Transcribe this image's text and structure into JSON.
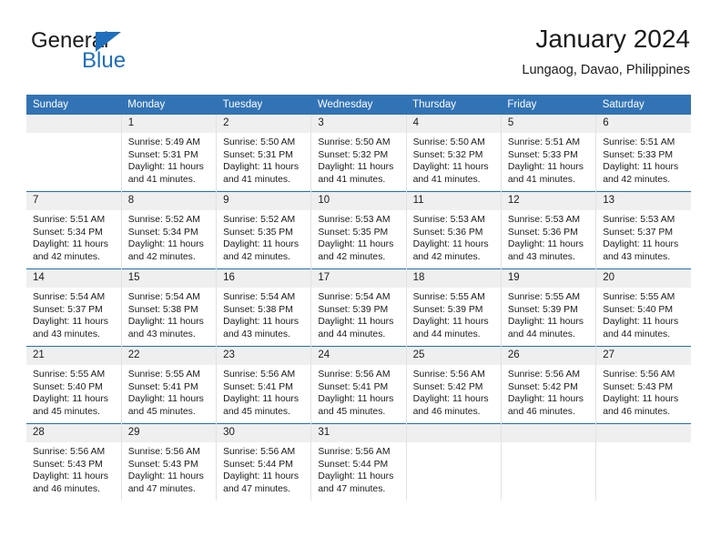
{
  "brand": {
    "name_top": "General",
    "name_bottom": "Blue",
    "triangle_icon": "brand-triangle-icon",
    "accent_color": "#1f6fbc"
  },
  "header": {
    "title": "January 2024",
    "subtitle": "Lungaog, Davao, Philippines",
    "header_bg_color": "#3273b5",
    "header_text_color": "#ffffff",
    "daynum_bg_color": "#efefef",
    "row_rule_color": "#1f6fbc"
  },
  "weekday_headers": [
    "Sunday",
    "Monday",
    "Tuesday",
    "Wednesday",
    "Thursday",
    "Friday",
    "Saturday"
  ],
  "weeks": [
    [
      {
        "day": "",
        "sunrise": "",
        "sunset": "",
        "daylight": "",
        "empty": true
      },
      {
        "day": "1",
        "sunrise": "Sunrise: 5:49 AM",
        "sunset": "Sunset: 5:31 PM",
        "daylight": "Daylight: 11 hours and 41 minutes.",
        "empty": false
      },
      {
        "day": "2",
        "sunrise": "Sunrise: 5:50 AM",
        "sunset": "Sunset: 5:31 PM",
        "daylight": "Daylight: 11 hours and 41 minutes.",
        "empty": false
      },
      {
        "day": "3",
        "sunrise": "Sunrise: 5:50 AM",
        "sunset": "Sunset: 5:32 PM",
        "daylight": "Daylight: 11 hours and 41 minutes.",
        "empty": false
      },
      {
        "day": "4",
        "sunrise": "Sunrise: 5:50 AM",
        "sunset": "Sunset: 5:32 PM",
        "daylight": "Daylight: 11 hours and 41 minutes.",
        "empty": false
      },
      {
        "day": "5",
        "sunrise": "Sunrise: 5:51 AM",
        "sunset": "Sunset: 5:33 PM",
        "daylight": "Daylight: 11 hours and 41 minutes.",
        "empty": false
      },
      {
        "day": "6",
        "sunrise": "Sunrise: 5:51 AM",
        "sunset": "Sunset: 5:33 PM",
        "daylight": "Daylight: 11 hours and 42 minutes.",
        "empty": false
      }
    ],
    [
      {
        "day": "7",
        "sunrise": "Sunrise: 5:51 AM",
        "sunset": "Sunset: 5:34 PM",
        "daylight": "Daylight: 11 hours and 42 minutes.",
        "empty": false
      },
      {
        "day": "8",
        "sunrise": "Sunrise: 5:52 AM",
        "sunset": "Sunset: 5:34 PM",
        "daylight": "Daylight: 11 hours and 42 minutes.",
        "empty": false
      },
      {
        "day": "9",
        "sunrise": "Sunrise: 5:52 AM",
        "sunset": "Sunset: 5:35 PM",
        "daylight": "Daylight: 11 hours and 42 minutes.",
        "empty": false
      },
      {
        "day": "10",
        "sunrise": "Sunrise: 5:53 AM",
        "sunset": "Sunset: 5:35 PM",
        "daylight": "Daylight: 11 hours and 42 minutes.",
        "empty": false
      },
      {
        "day": "11",
        "sunrise": "Sunrise: 5:53 AM",
        "sunset": "Sunset: 5:36 PM",
        "daylight": "Daylight: 11 hours and 42 minutes.",
        "empty": false
      },
      {
        "day": "12",
        "sunrise": "Sunrise: 5:53 AM",
        "sunset": "Sunset: 5:36 PM",
        "daylight": "Daylight: 11 hours and 43 minutes.",
        "empty": false
      },
      {
        "day": "13",
        "sunrise": "Sunrise: 5:53 AM",
        "sunset": "Sunset: 5:37 PM",
        "daylight": "Daylight: 11 hours and 43 minutes.",
        "empty": false
      }
    ],
    [
      {
        "day": "14",
        "sunrise": "Sunrise: 5:54 AM",
        "sunset": "Sunset: 5:37 PM",
        "daylight": "Daylight: 11 hours and 43 minutes.",
        "empty": false
      },
      {
        "day": "15",
        "sunrise": "Sunrise: 5:54 AM",
        "sunset": "Sunset: 5:38 PM",
        "daylight": "Daylight: 11 hours and 43 minutes.",
        "empty": false
      },
      {
        "day": "16",
        "sunrise": "Sunrise: 5:54 AM",
        "sunset": "Sunset: 5:38 PM",
        "daylight": "Daylight: 11 hours and 43 minutes.",
        "empty": false
      },
      {
        "day": "17",
        "sunrise": "Sunrise: 5:54 AM",
        "sunset": "Sunset: 5:39 PM",
        "daylight": "Daylight: 11 hours and 44 minutes.",
        "empty": false
      },
      {
        "day": "18",
        "sunrise": "Sunrise: 5:55 AM",
        "sunset": "Sunset: 5:39 PM",
        "daylight": "Daylight: 11 hours and 44 minutes.",
        "empty": false
      },
      {
        "day": "19",
        "sunrise": "Sunrise: 5:55 AM",
        "sunset": "Sunset: 5:39 PM",
        "daylight": "Daylight: 11 hours and 44 minutes.",
        "empty": false
      },
      {
        "day": "20",
        "sunrise": "Sunrise: 5:55 AM",
        "sunset": "Sunset: 5:40 PM",
        "daylight": "Daylight: 11 hours and 44 minutes.",
        "empty": false
      }
    ],
    [
      {
        "day": "21",
        "sunrise": "Sunrise: 5:55 AM",
        "sunset": "Sunset: 5:40 PM",
        "daylight": "Daylight: 11 hours and 45 minutes.",
        "empty": false
      },
      {
        "day": "22",
        "sunrise": "Sunrise: 5:55 AM",
        "sunset": "Sunset: 5:41 PM",
        "daylight": "Daylight: 11 hours and 45 minutes.",
        "empty": false
      },
      {
        "day": "23",
        "sunrise": "Sunrise: 5:56 AM",
        "sunset": "Sunset: 5:41 PM",
        "daylight": "Daylight: 11 hours and 45 minutes.",
        "empty": false
      },
      {
        "day": "24",
        "sunrise": "Sunrise: 5:56 AM",
        "sunset": "Sunset: 5:41 PM",
        "daylight": "Daylight: 11 hours and 45 minutes.",
        "empty": false
      },
      {
        "day": "25",
        "sunrise": "Sunrise: 5:56 AM",
        "sunset": "Sunset: 5:42 PM",
        "daylight": "Daylight: 11 hours and 46 minutes.",
        "empty": false
      },
      {
        "day": "26",
        "sunrise": "Sunrise: 5:56 AM",
        "sunset": "Sunset: 5:42 PM",
        "daylight": "Daylight: 11 hours and 46 minutes.",
        "empty": false
      },
      {
        "day": "27",
        "sunrise": "Sunrise: 5:56 AM",
        "sunset": "Sunset: 5:43 PM",
        "daylight": "Daylight: 11 hours and 46 minutes.",
        "empty": false
      }
    ],
    [
      {
        "day": "28",
        "sunrise": "Sunrise: 5:56 AM",
        "sunset": "Sunset: 5:43 PM",
        "daylight": "Daylight: 11 hours and 46 minutes.",
        "empty": false
      },
      {
        "day": "29",
        "sunrise": "Sunrise: 5:56 AM",
        "sunset": "Sunset: 5:43 PM",
        "daylight": "Daylight: 11 hours and 47 minutes.",
        "empty": false
      },
      {
        "day": "30",
        "sunrise": "Sunrise: 5:56 AM",
        "sunset": "Sunset: 5:44 PM",
        "daylight": "Daylight: 11 hours and 47 minutes.",
        "empty": false
      },
      {
        "day": "31",
        "sunrise": "Sunrise: 5:56 AM",
        "sunset": "Sunset: 5:44 PM",
        "daylight": "Daylight: 11 hours and 47 minutes.",
        "empty": false
      },
      {
        "day": "",
        "sunrise": "",
        "sunset": "",
        "daylight": "",
        "empty": true
      },
      {
        "day": "",
        "sunrise": "",
        "sunset": "",
        "daylight": "",
        "empty": true
      },
      {
        "day": "",
        "sunrise": "",
        "sunset": "",
        "daylight": "",
        "empty": true
      }
    ]
  ]
}
